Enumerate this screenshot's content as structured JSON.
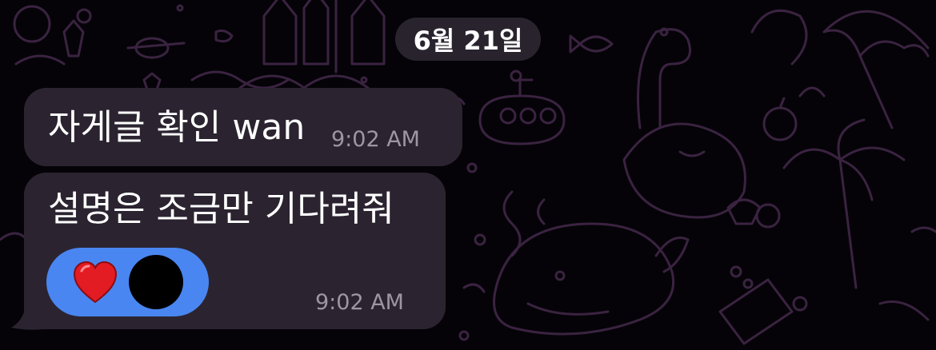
{
  "date_separator": "6월 21일",
  "messages": [
    {
      "text": "자게글 확인 wan",
      "time": "9:02 AM"
    },
    {
      "text": "설명은 조금만 기다려줘",
      "time": "9:02 AM",
      "reactions": {
        "emoji_icon": "red-heart-icon",
        "reactor": "avatar"
      }
    }
  ],
  "colors": {
    "background": "#050308",
    "doodle": "#3a2340",
    "bubble": "#2b2430",
    "reaction_pill": "#4a86f2",
    "timestamp": "#9e97a3"
  }
}
